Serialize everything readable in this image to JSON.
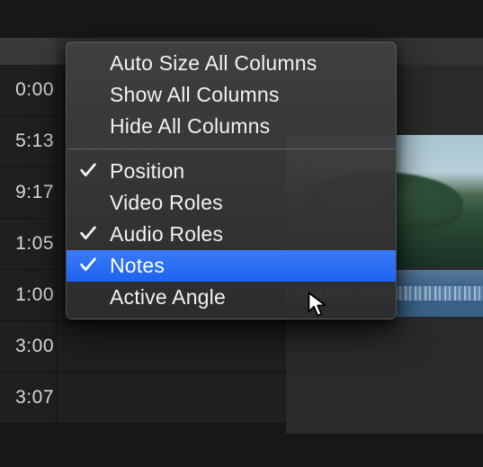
{
  "timeline": {
    "timecodes": [
      "0:00",
      "5:13",
      "9:17",
      "1:05",
      "1:00",
      "3:00",
      "3:07"
    ]
  },
  "menu": {
    "items": [
      {
        "label": "Auto Size All Columns",
        "checked": false,
        "highlight": false
      },
      {
        "label": "Show All Columns",
        "checked": false,
        "highlight": false
      },
      {
        "label": "Hide All Columns",
        "checked": false,
        "highlight": false
      }
    ],
    "columns": [
      {
        "label": "Position",
        "checked": true,
        "highlight": false
      },
      {
        "label": "Video Roles",
        "checked": false,
        "highlight": false
      },
      {
        "label": "Audio Roles",
        "checked": true,
        "highlight": false
      },
      {
        "label": "Notes",
        "checked": true,
        "highlight": true
      },
      {
        "label": "Active Angle",
        "checked": false,
        "highlight": false
      }
    ]
  },
  "colors": {
    "highlight": "#2f6ff2"
  }
}
